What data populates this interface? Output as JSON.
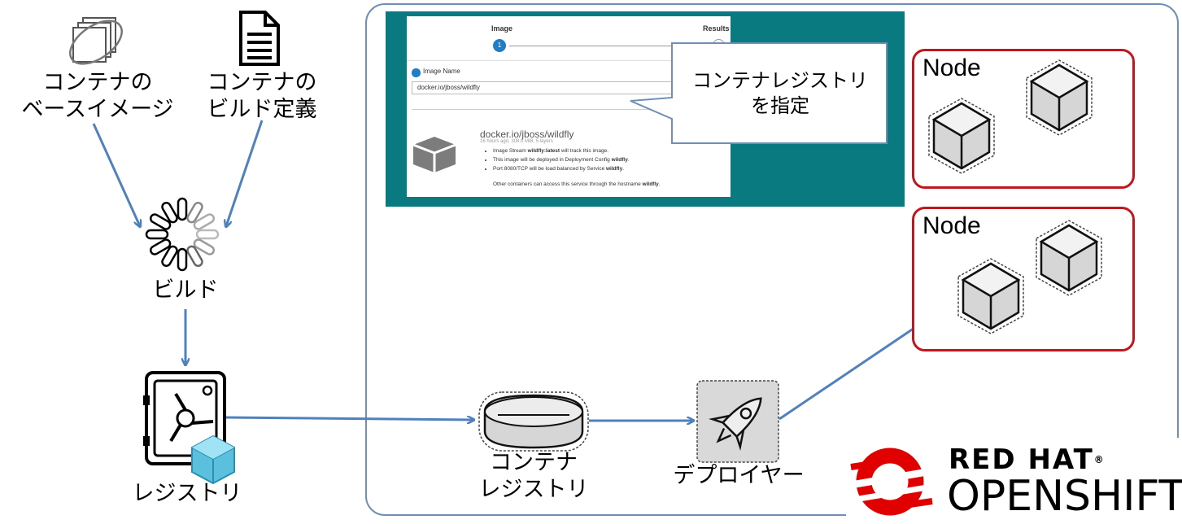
{
  "labels": {
    "base_image": [
      "コンテナの",
      "ベースイメージ"
    ],
    "build_def": [
      "コンテナの",
      "ビルド定義"
    ],
    "build": "ビルド",
    "registry": "レジストリ",
    "container_registry": [
      "コンテナ",
      "レジストリ"
    ],
    "deployer": "デプロイヤー"
  },
  "callout": [
    "コンテナレジストリ",
    "を指定"
  ],
  "nodes": [
    {
      "label": "Node"
    },
    {
      "label": "Node"
    }
  ],
  "screenshot": {
    "step1_label": "Image",
    "step1_number": "1",
    "step2_label": "Results",
    "radio_label": "Image Name",
    "input_value": "docker.io/jboss/wildfly",
    "image_title": "docker.io/jboss/wildfly",
    "image_meta": "16 hours ago, 308.0 MiB, 5 layers",
    "bullets": [
      {
        "pre": "Image Stream ",
        "bold": "wildfly:latest",
        "post": " will track this image."
      },
      {
        "pre": "This image will be deployed in Deployment Config ",
        "bold": "wildfly",
        "post": "."
      },
      {
        "pre": "Port 8080/TCP will be load balanced by Service ",
        "bold": "wildfly",
        "post": "."
      }
    ],
    "note_pre": "Other containers can access this service through the hostname ",
    "note_bold": "wildfly",
    "note_post": "."
  },
  "logo": {
    "line1": "RED HAT",
    "line2": "OPENSHIFT",
    "mark": "®"
  },
  "colors": {
    "arrow": "#4f81bd",
    "node_border": "#c0161d",
    "panel": "#087a80",
    "logo_red": "#e00000",
    "frame": "#6f8fb5"
  },
  "icons": [
    "images-icon",
    "document-icon",
    "build-spinner-icon",
    "safe-icon",
    "cube-icon",
    "database-icon",
    "rocket-icon",
    "pod-cube-icon"
  ]
}
